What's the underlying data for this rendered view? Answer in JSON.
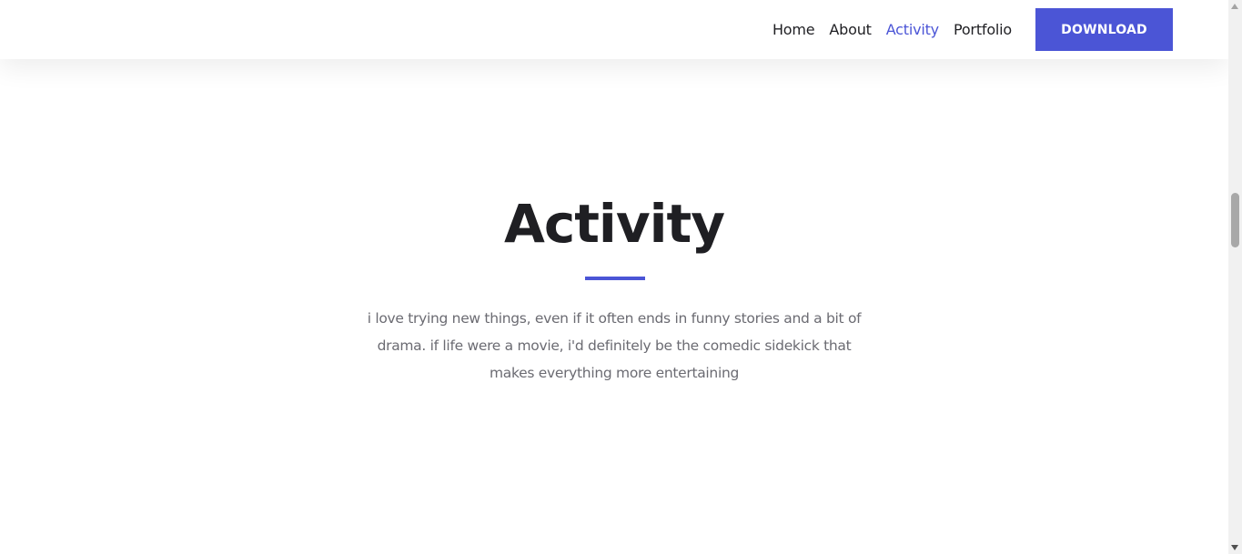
{
  "nav": {
    "items": [
      {
        "label": "Home"
      },
      {
        "label": "About"
      },
      {
        "label": "Activity",
        "active": true
      },
      {
        "label": "Portfolio"
      }
    ],
    "download_label": "DOWNLOAD"
  },
  "section": {
    "title": "Activity",
    "description": "i love trying new things, even if it often ends in funny stories and a bit of drama. if life were a movie, i'd definitely be the comedic sidekick that makes everything more entertaining"
  },
  "colors": {
    "accent": "#4b55d6",
    "heading": "#1f1f23",
    "body_text": "#6b6b72",
    "background": "#ffffff"
  },
  "icons": {
    "scroll_up": "scroll-up-arrow-icon",
    "scroll_down": "scroll-down-arrow-icon"
  }
}
